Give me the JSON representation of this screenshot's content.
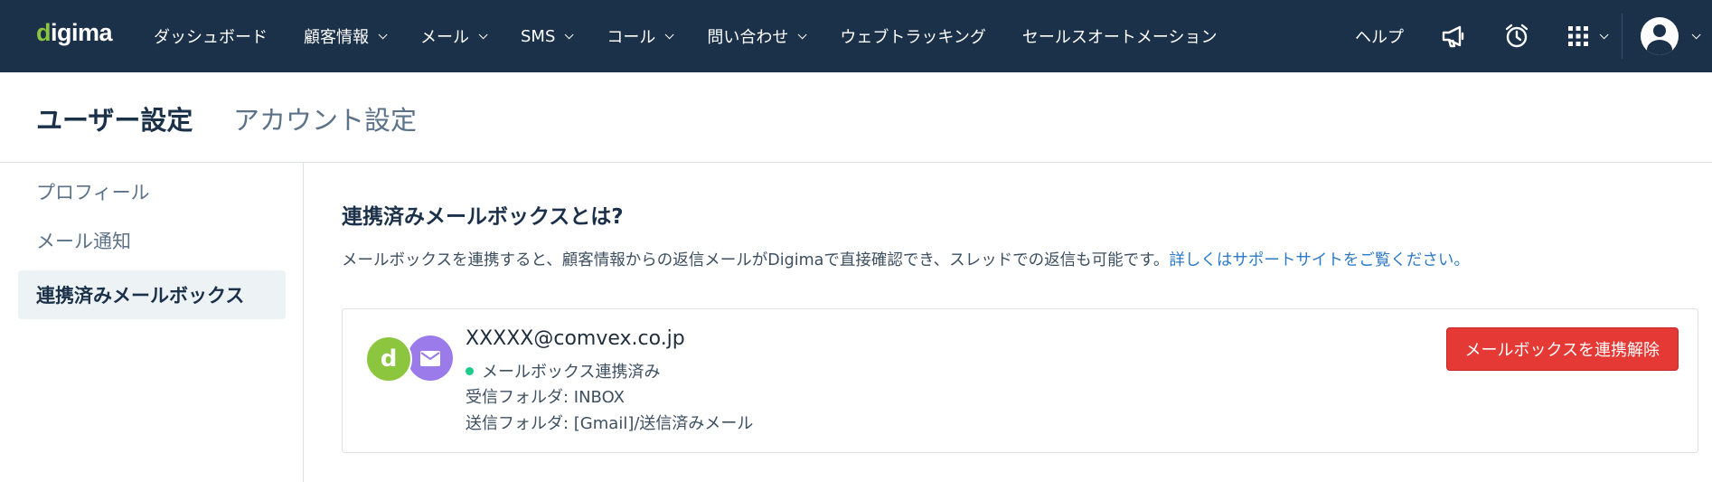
{
  "nav": {
    "logo_prefix": "d",
    "logo_rest": "igima",
    "items": [
      {
        "label": "ダッシュボード"
      },
      {
        "label": "顧客情報"
      },
      {
        "label": "メール"
      },
      {
        "label": "SMS"
      },
      {
        "label": "コール"
      },
      {
        "label": "問い合わせ"
      },
      {
        "label": "ウェブトラッキング"
      },
      {
        "label": "セールスオートメーション"
      }
    ],
    "help_label": "ヘルプ",
    "icons": [
      "megaphone-icon",
      "alarm-clock-icon",
      "apps-grid-icon",
      "user-avatar-icon"
    ]
  },
  "header": {
    "active_tab": "ユーザー設定",
    "inactive_tab": "アカウント設定"
  },
  "sidebar": {
    "items": [
      {
        "label": "プロフィール"
      },
      {
        "label": "メール通知"
      },
      {
        "label": "連携済みメールボックス"
      }
    ]
  },
  "main": {
    "title": "連携済みメールボックスとは?",
    "description": "メールボックスを連携すると、顧客情報からの返信メールがDigimaで直接確認でき、スレッドでの返信も可能です。",
    "support_link": "詳しくはサポートサイトをご覧ください。",
    "mailbox": {
      "email": "XXXXX@comvex.co.jp",
      "status": "メールボックス連携済み",
      "status_color": "#1ccc88",
      "inbox_folder": "受信フォルダ: INBOX",
      "sent_folder": "送信フォルダ: [Gmail]/送信済みメール",
      "badge_digima_letter": "d",
      "disconnect_label": "メールボックスを連携解除"
    }
  },
  "colors": {
    "nav_bg": "#1b3049",
    "brand_green": "#8cc63f",
    "mail_purple": "#9b7bea",
    "danger": "#e53935",
    "link": "#2d7ac6"
  }
}
